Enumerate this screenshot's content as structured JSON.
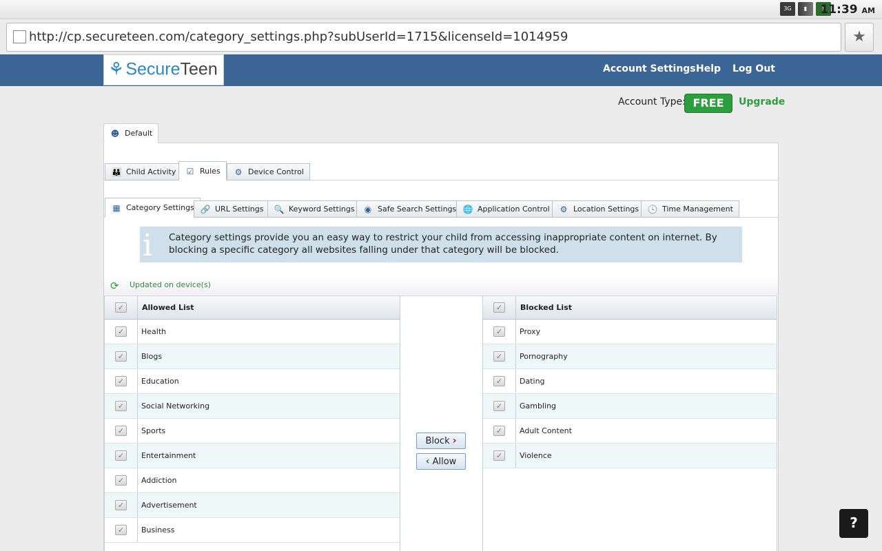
{
  "statusbar": {
    "signal_label": "3G",
    "time": "11:39",
    "ampm": "AM"
  },
  "browser": {
    "url": "http://cp.secureteen.com/category_settings.php?subUserId=1715&licenseId=1014959"
  },
  "header": {
    "logo_word1": "Secure",
    "logo_word2": "Teen",
    "nav": {
      "account_settings": "Account Settings",
      "help": "Help",
      "logout": "Log Out"
    }
  },
  "account": {
    "type_label": "Account Type:",
    "type_value": "FREE",
    "upgrade": "Upgrade"
  },
  "profile_tab": "Default",
  "main_tabs": [
    "Child Activity",
    "Rules",
    "Device Control"
  ],
  "sub_tabs": [
    "Category Settings",
    "URL Settings",
    "Keyword Settings",
    "Safe Search Settings",
    "Application Control",
    "Location Settings",
    "Time Management"
  ],
  "info": {
    "text": "Category settings provide you an easy way to restrict your child from accessing inappropriate content on internet. By blocking a specific category all websites falling under that category will be blocked."
  },
  "updated_status": "Updated on device(s)",
  "allowed": {
    "header": "Allowed List",
    "items": [
      "Health",
      "Blogs",
      "Education",
      "Social Networking",
      "Sports",
      "Entertainment",
      "Addiction",
      "Advertisement",
      "Business"
    ]
  },
  "blocked": {
    "header": "Blocked List",
    "items": [
      "Proxy",
      "Pornography",
      "Dating",
      "Gambling",
      "Adult Content",
      "Violence"
    ]
  },
  "buttons": {
    "block": "Block",
    "allow": "Allow"
  },
  "colors": {
    "header_bg": "#3b6595",
    "free_badge": "#2d9e3d",
    "info_bg": "#cfe0ea"
  }
}
